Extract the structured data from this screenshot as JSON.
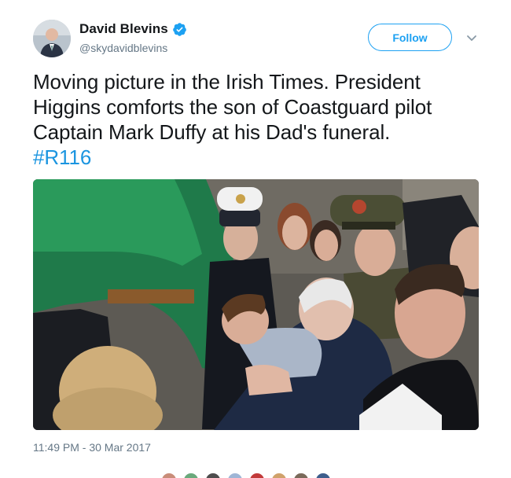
{
  "author": {
    "display_name": "David Blevins",
    "handle": "@skydavidblevins",
    "verified_icon": "verified-badge-icon",
    "avatar_icon": "profile-photo"
  },
  "follow_button": {
    "label": "Follow"
  },
  "menu_caret_icon": "chevron-down-icon",
  "tweet": {
    "text": "Moving picture in the Irish Times. President Higgins comforts the son of Coastguard pilot Captain Mark Duffy at his Dad's funeral.",
    "hashtag": "#R116"
  },
  "media": {
    "type": "photo"
  },
  "timestamp": "11:49 PM - 30 Mar 2017",
  "colors": {
    "accent": "#1da1f2",
    "hashtag": "#1b95e0",
    "secondary_text": "#657786"
  }
}
